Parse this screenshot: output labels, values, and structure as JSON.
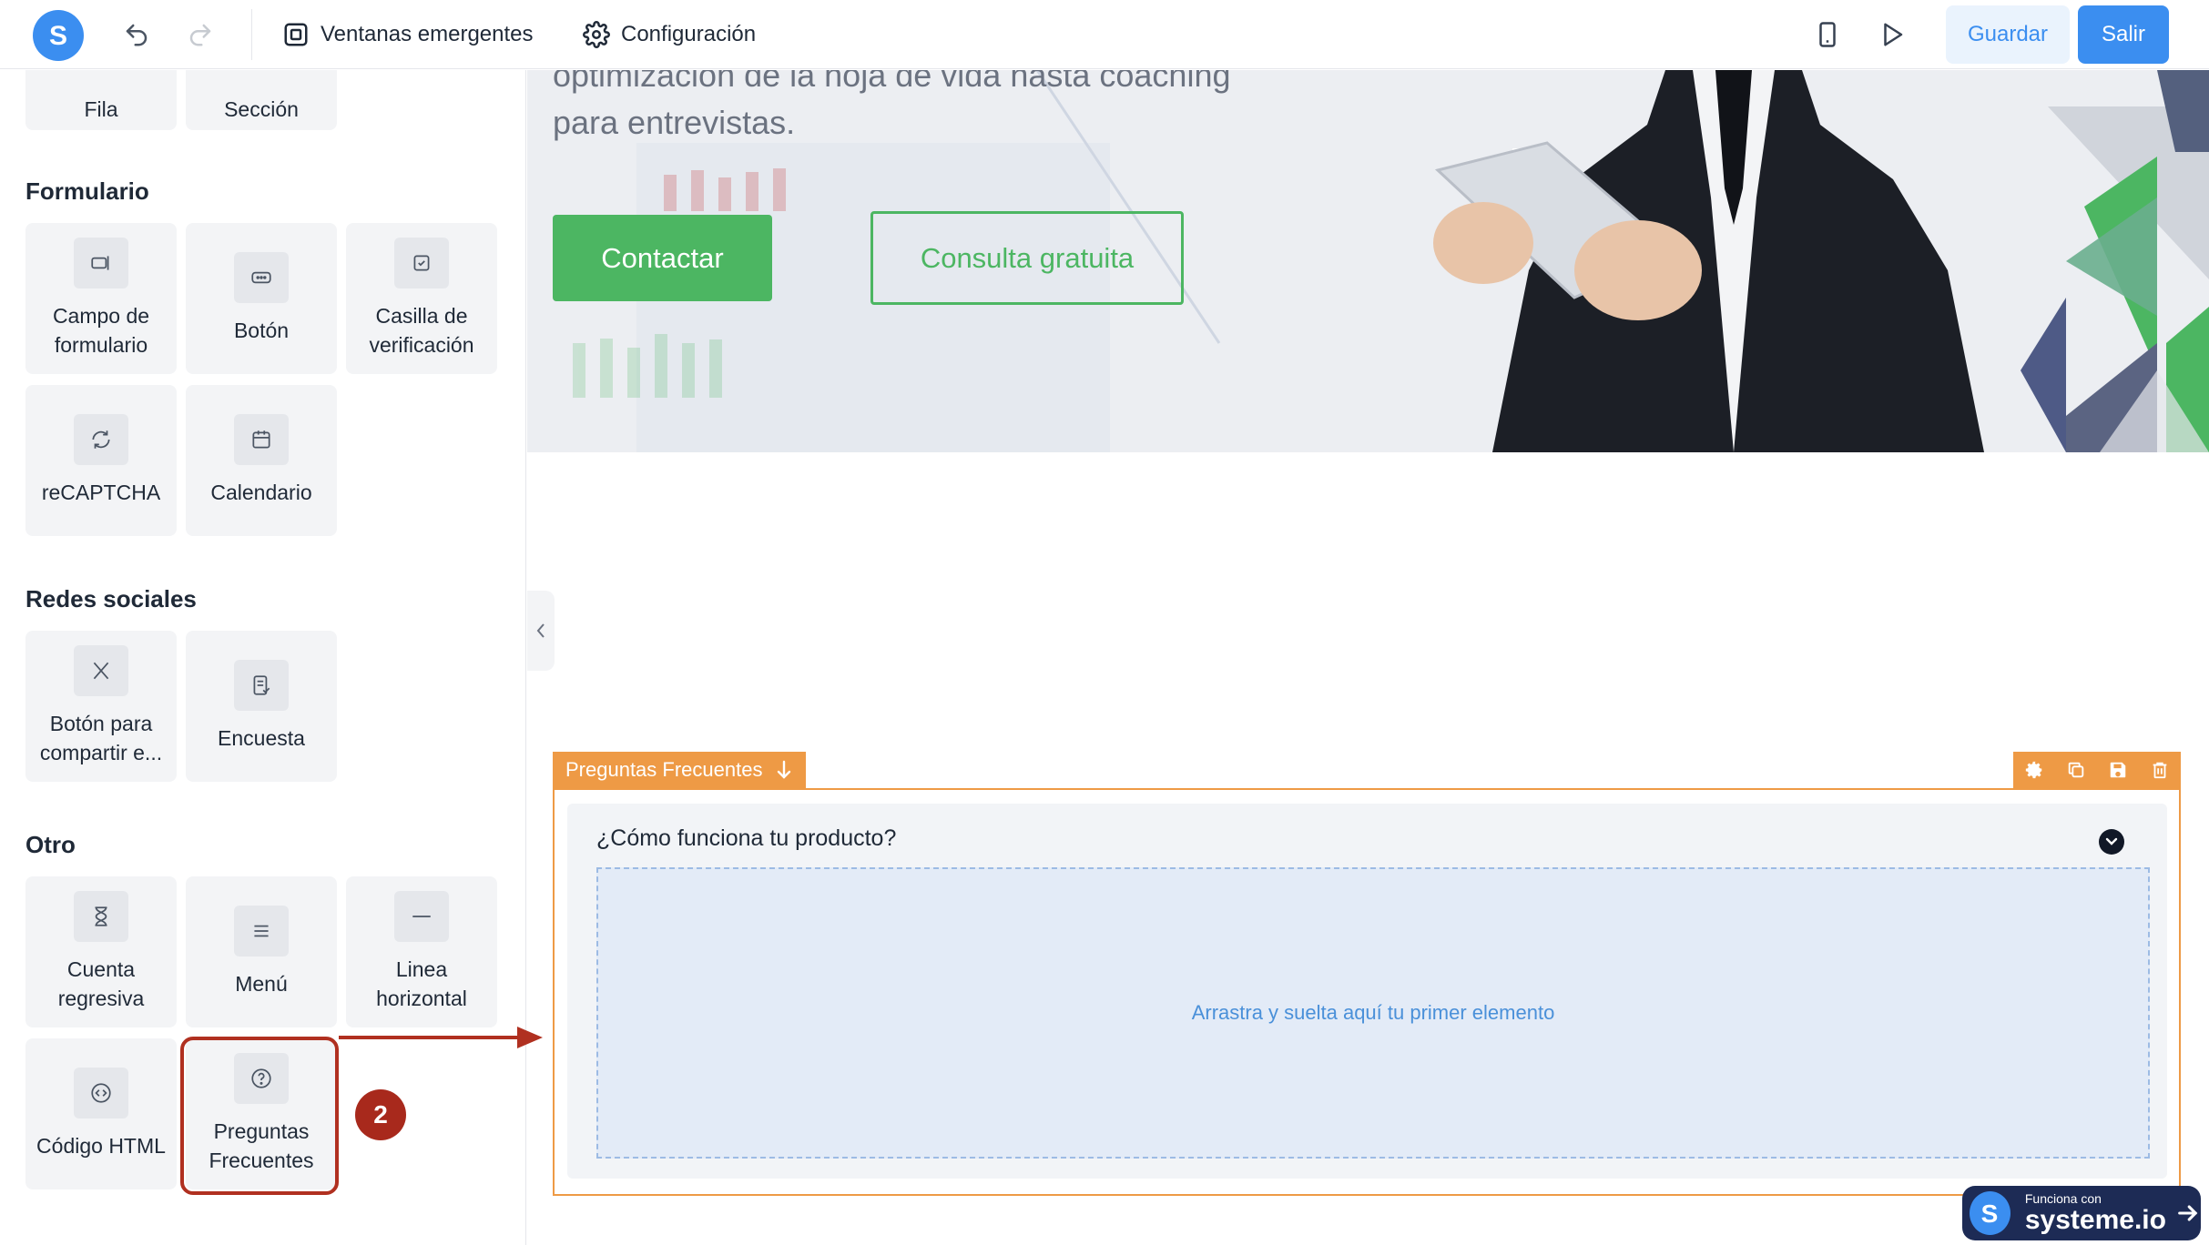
{
  "toolbar": {
    "popups_label": "Ventanas emergentes",
    "settings_label": "Configuración",
    "save_label": "Guardar",
    "exit_label": "Salir"
  },
  "sidebar": {
    "layout_tiles": [
      "Fila",
      "Sección"
    ],
    "sections": {
      "form_title": "Formulario",
      "social_title": "Redes sociales",
      "other_title": "Otro"
    },
    "form_tiles": [
      "Campo de formulario",
      "Botón",
      "Casilla de verificación",
      "reCAPTCHA",
      "Calendario"
    ],
    "social_tiles": [
      "Botón para compartir e...",
      "Encuesta"
    ],
    "other_tiles": [
      "Cuenta regresiva",
      "Menú",
      "Linea horizontal",
      "Código HTML",
      "Preguntas Frecuentes"
    ]
  },
  "step_badge": "2",
  "hero": {
    "text_line1": "optimización de la hoja de vida hasta coaching",
    "text_line2": "para entrevistas.",
    "primary_button": "Contactar",
    "secondary_button": "Consulta gratuita"
  },
  "faq": {
    "element_label": "Preguntas Frecuentes",
    "question": "¿Cómo funciona tu producto?",
    "dropzone_text": "Arrastra y suelta aquí tu primer elemento"
  },
  "powered_badge": {
    "small": "Funciona con",
    "brand": "systeme.io"
  },
  "colors": {
    "accent_blue": "#3b8ef0",
    "green": "#4cb662",
    "orange": "#ee9a45",
    "annotation_red": "#a8291c"
  }
}
